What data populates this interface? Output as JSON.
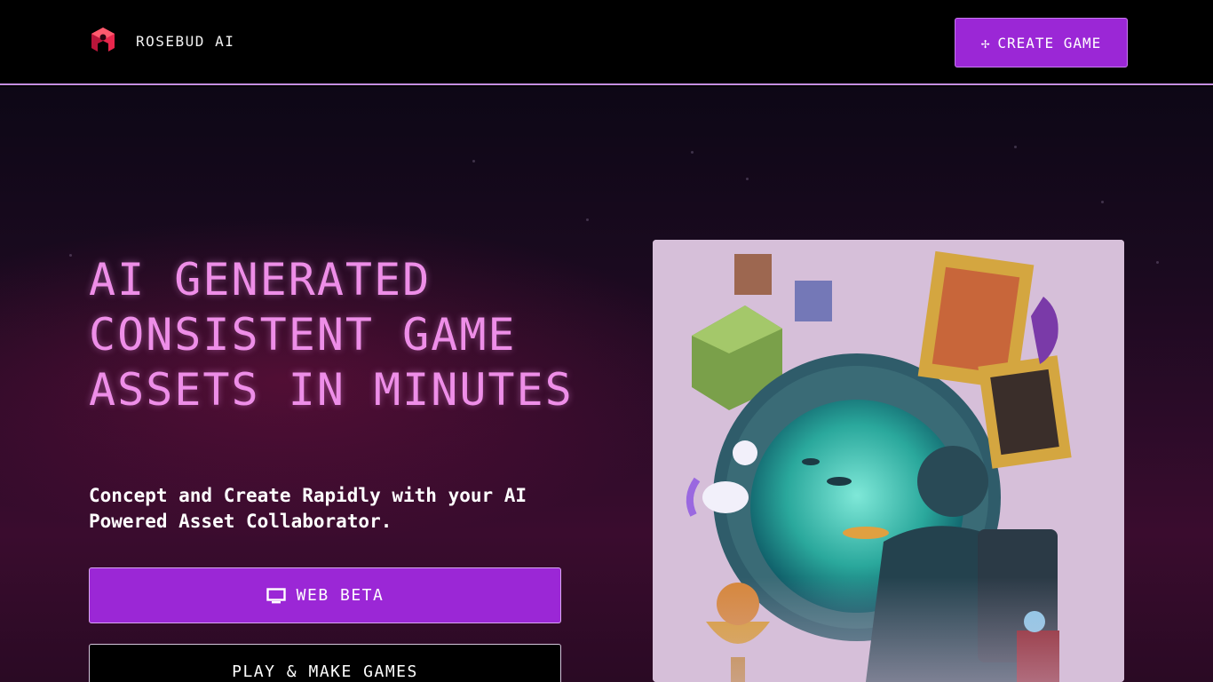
{
  "header": {
    "brand_name": "ROSEBUD AI",
    "logo_icon": "rosebud-logo-icon",
    "create_button_label": "CREATE GAME",
    "create_button_icon": "plus-icon"
  },
  "hero": {
    "headline": "AI GENERATED CONSISTENT GAME ASSETS IN MINUTES",
    "subheadline": "Concept and Create Rapidly with your AI Powered Asset Collaborator.",
    "web_beta_label": "WEB BETA",
    "web_beta_icon": "monitor-icon",
    "play_button_label": "PLAY & MAKE GAMES"
  },
  "colors": {
    "accent": "#9b27d6",
    "headline": "#ee8ee8",
    "divider": "#c48ee0",
    "logo": "#e8264c"
  }
}
